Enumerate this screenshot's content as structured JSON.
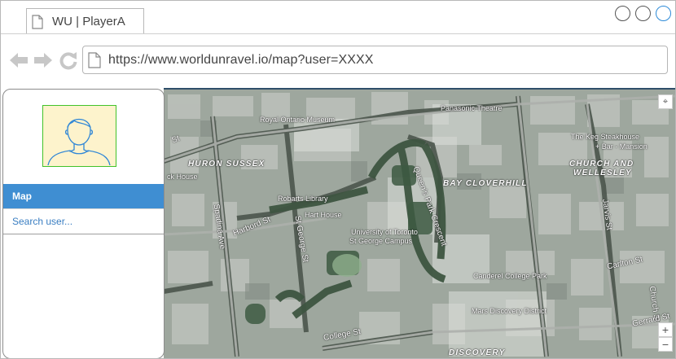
{
  "browser": {
    "tab_title": "WU | PlayerA",
    "url": "https://www.worldunravel.io/map?user=XXXX",
    "accent": "#2c8ad8"
  },
  "sidebar": {
    "menu": [
      {
        "label": "Map",
        "active": true
      },
      {
        "label": "Search user..."
      }
    ],
    "active_color": "#3f8ed2",
    "avatar_border": "#42c22a",
    "avatar_bg": "#fdf3cc"
  },
  "map": {
    "labels": {
      "royal_ontario_museum": "Royal Ontario Museum",
      "panasonic_theatre": "Panasonic Theatre",
      "keg_steakhouse_1": "The Keg Steakhouse",
      "keg_steakhouse_2": "+ Bar - Mansion",
      "huron_sussex": "HURON SUSSEX",
      "church_wellesley_1": "CHURCH AND",
      "church_wellesley_2": "WELLESLEY",
      "bay_cloverhill": "BAY CLOVERHILL",
      "robarts_library": "Robarts Library",
      "hart_house": "Hart House",
      "uoft_1": "University of Toronto",
      "uoft_2": "St George Campus",
      "harbord_st": "Harbord St",
      "st_george_st": "St George St",
      "spadina_ave": "Spadina Ave",
      "queens_park_crescent": "Queen's Park Crescent",
      "canderel_college_park": "Canderel College Park",
      "mars_discovery_district": "Mars Discovery District",
      "carlton_st": "Carlton St",
      "college_st": "College St",
      "discovery": "DISCOVERY",
      "huron_st": "Huron St",
      "jarvis_st": "Jarvis St",
      "church_st": "Church St",
      "gerrard_st": "Gerrard St",
      "wellesley_st": "Wellesley St E",
      "house_partial": "ck House",
      "bridge_partial": "lge",
      "cut_left": "St"
    },
    "controls": {
      "zoom_in": "+",
      "zoom_out": "−",
      "locate": "⌖"
    }
  }
}
